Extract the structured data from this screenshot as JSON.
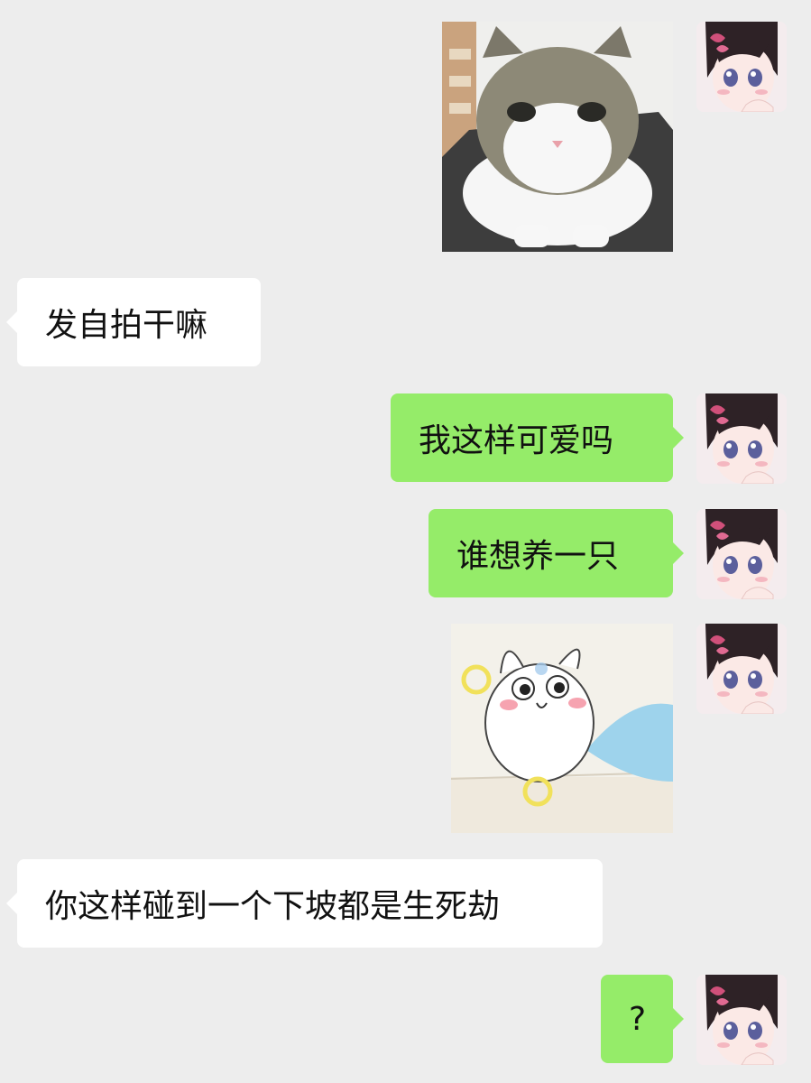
{
  "messages": [
    {
      "side": "right",
      "type": "image",
      "image": "cat-photo"
    },
    {
      "side": "left",
      "type": "text",
      "text": "发自拍干嘛"
    },
    {
      "side": "right",
      "type": "text",
      "text": "我这样可爱吗"
    },
    {
      "side": "right",
      "type": "text",
      "text": "谁想养一只"
    },
    {
      "side": "right",
      "type": "image",
      "image": "cartoon-hamster-sticker"
    },
    {
      "side": "left",
      "type": "text",
      "text": "你这样碰到一个下坡都是生死劫"
    },
    {
      "side": "right",
      "type": "text",
      "text": "?"
    }
  ],
  "colors": {
    "background": "#ededed",
    "left_bubble": "#ffffff",
    "right_bubble": "#95ec69"
  },
  "avatar": {
    "icon": "anime-girl-avatar"
  }
}
